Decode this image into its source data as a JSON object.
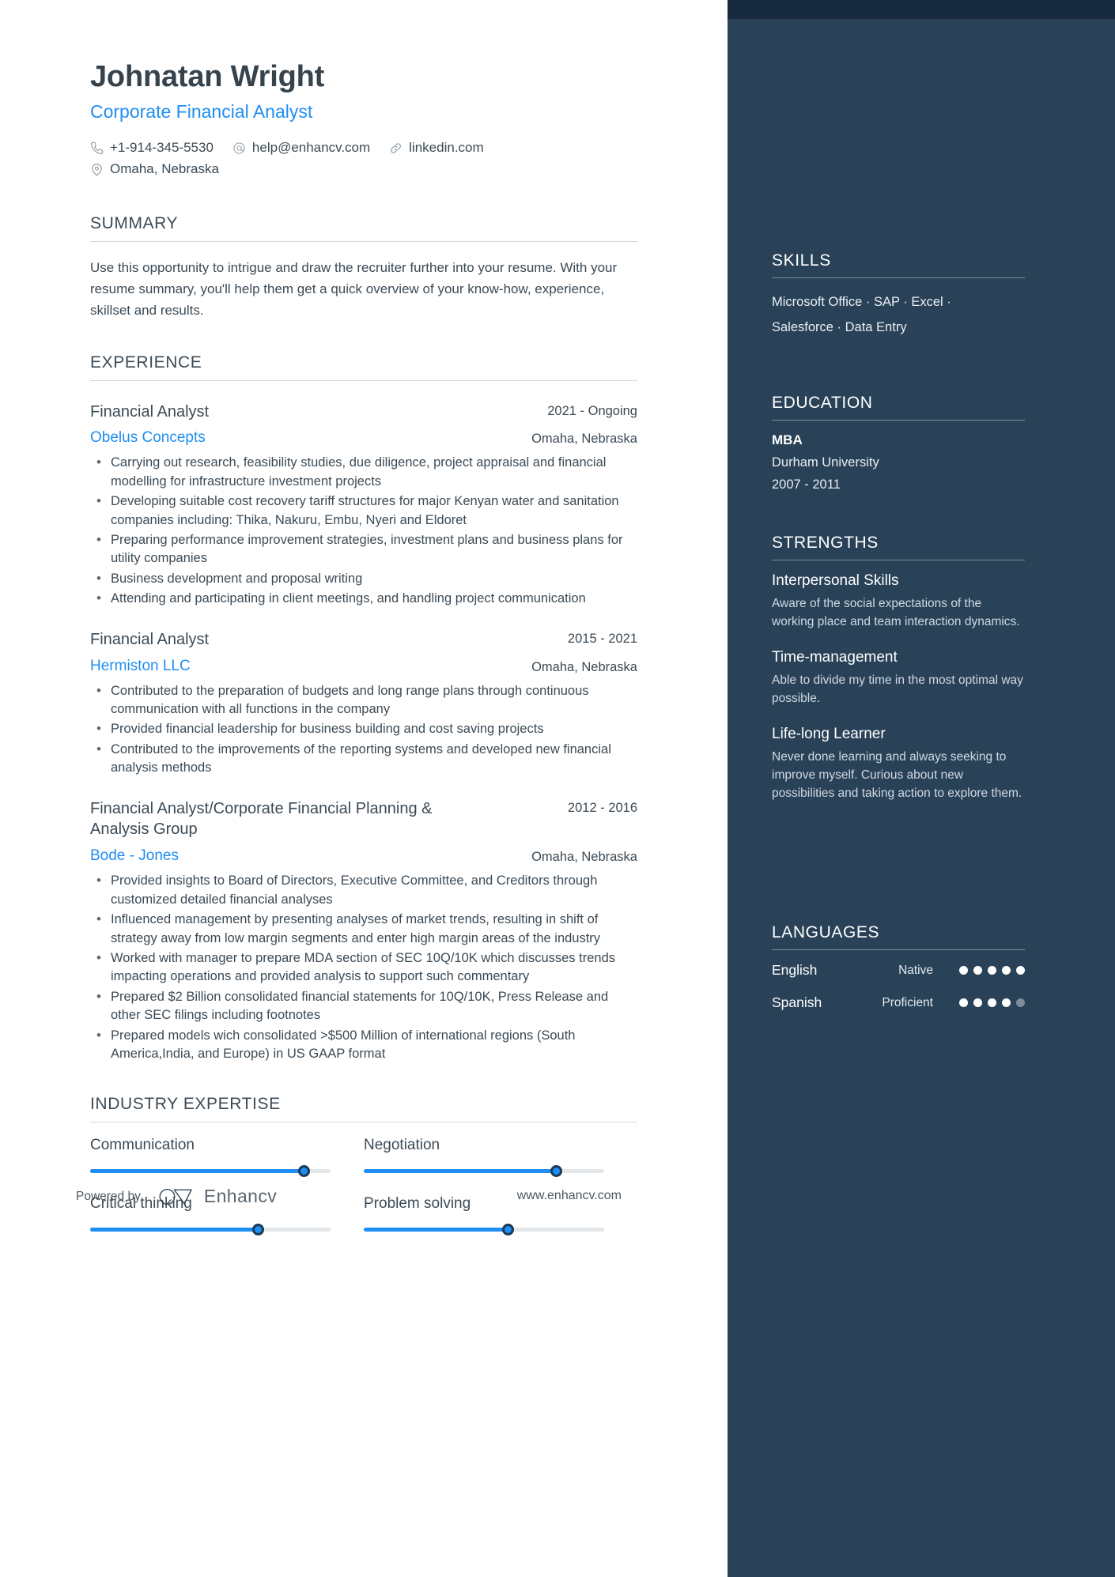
{
  "header": {
    "name": "Johnatan Wright",
    "job_title": "Corporate Financial Analyst",
    "contacts": [
      {
        "icon": "phone-icon",
        "text": "+1-914-345-5530"
      },
      {
        "icon": "email-icon",
        "text": "help@enhancv.com"
      },
      {
        "icon": "link-icon",
        "text": "linkedin.com"
      },
      {
        "icon": "location-pin-icon",
        "text": "Omaha, Nebraska"
      }
    ]
  },
  "summary": {
    "title": "SUMMARY",
    "text": "Use this opportunity to intrigue and draw the recruiter further into your resume. With your resume summary, you'll help them get a quick overview of your know-how, experience, skillset and results."
  },
  "experience": {
    "title": "EXPERIENCE",
    "jobs": [
      {
        "role": "Financial Analyst",
        "dates": "2021 - Ongoing",
        "company": "Obelus Concepts",
        "location": "Omaha, Nebraska",
        "bullets": [
          "Carrying out research, feasibility studies, due diligence, project appraisal and financial modelling for infrastructure investment projects",
          "Developing suitable cost  recovery tariff structures for major Kenyan water and sanitation companies including: Thika, Nakuru, Embu, Nyeri and Eldoret",
          "Preparing performance improvement strategies, investment plans and business plans for utility companies",
          "Business development and proposal writing",
          "Attending and participating in client meetings, and handling project communication"
        ]
      },
      {
        "role": "Financial Analyst",
        "dates": "2015 - 2021",
        "company": "Hermiston LLC",
        "location": "Omaha, Nebraska",
        "bullets": [
          "Contributed to the preparation of budgets and long range plans through continuous communication with all functions in the company",
          "Provided financial leadership for business building and cost saving projects",
          "Contributed to the improvements of the reporting systems and developed new financial analysis methods"
        ]
      },
      {
        "role": "Financial Analyst/Corporate Financial Planning & Analysis Group",
        "dates": "2012 - 2016",
        "company": "Bode - Jones",
        "location": "Omaha, Nebraska",
        "bullets": [
          "Provided insights to Board of Directors, Executive Committee, and Creditors through customized detailed financial analyses",
          "Influenced management by presenting analyses of market trends, resulting in shift of strategy away from low margin segments and enter high margin areas of the industry",
          "Worked with manager to prepare MDA section of SEC 10Q/10K which discusses trends impacting operations and provided analysis to support such commentary",
          "Prepared $2 Billion consolidated financial statements for 10Q/10K, Press Release and other SEC filings including footnotes",
          "Prepared models wich consolidated >$500 Million of international regions (South America,India, and Europe) in US GAAP format"
        ]
      }
    ]
  },
  "industry_expertise": {
    "title": "INDUSTRY EXPERTISE",
    "items": [
      {
        "label": "Communication",
        "value": 89
      },
      {
        "label": "Negotiation",
        "value": 80
      },
      {
        "label": "Critical thinking",
        "value": 70
      },
      {
        "label": "Problem solving",
        "value": 60
      }
    ]
  },
  "sidebar": {
    "skills": {
      "title": "SKILLS",
      "lines": [
        "Microsoft Office · SAP · Excel ·",
        "Salesforce · Data Entry"
      ]
    },
    "education": {
      "title": "EDUCATION",
      "entries": [
        {
          "degree": "MBA",
          "school": "Durham University",
          "dates": "2007 - 2011"
        }
      ]
    },
    "strengths": {
      "title": "STRENGTHS",
      "items": [
        {
          "name": "Interpersonal Skills",
          "description": "Aware of the social expectations of the working place and team interaction dynamics."
        },
        {
          "name": "Time-management",
          "description": "Able to divide my time in the most optimal way possible."
        },
        {
          "name": "Life-long Learner",
          "description": "Never done learning and always seeking to improve myself. Curious about new possibilities and taking action to explore them."
        }
      ]
    },
    "languages": {
      "title": "LANGUAGES",
      "items": [
        {
          "name": "English",
          "level": "Native",
          "filled": 5,
          "total": 5
        },
        {
          "name": "Spanish",
          "level": "Proficient",
          "filled": 4,
          "total": 5
        }
      ]
    }
  },
  "footer": {
    "powered_by": "Powered by",
    "brand": "Enhancv",
    "url": "www.enhancv.com"
  },
  "colors": {
    "accent_blue": "#1f8ef1",
    "sidebar_bg": "#2a4258",
    "sidebar_strip": "#17293d",
    "text_dark": "#3c4a55"
  }
}
